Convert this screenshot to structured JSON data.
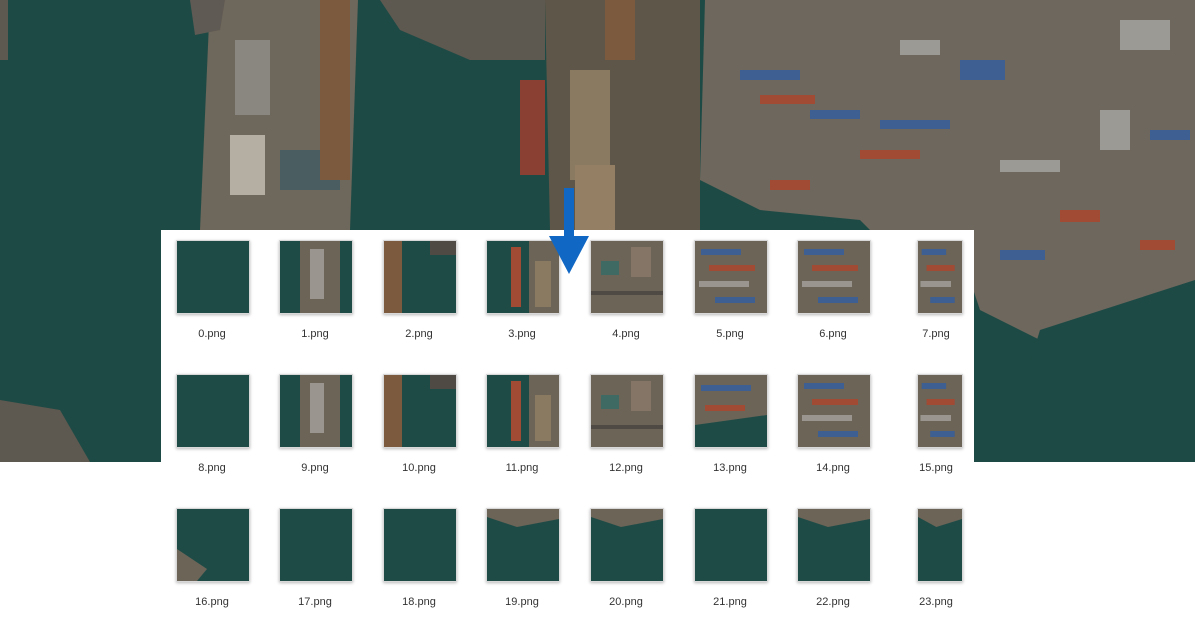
{
  "colors": {
    "water": "#1e4a45",
    "land": "#6b6457",
    "container_blue": "#3d5f92",
    "container_red": "#a14a34",
    "arrow": "#1167c4"
  },
  "icons": {
    "arrow": "down-arrow-icon"
  },
  "tiles": [
    {
      "file": "0.png",
      "kind": "water"
    },
    {
      "file": "1.png",
      "kind": "pier"
    },
    {
      "file": "2.png",
      "kind": "pier-edge"
    },
    {
      "file": "3.png",
      "kind": "ships"
    },
    {
      "file": "4.png",
      "kind": "land"
    },
    {
      "file": "5.png",
      "kind": "containers"
    },
    {
      "file": "6.png",
      "kind": "containers"
    },
    {
      "file": "7.png",
      "kind": "containers"
    },
    {
      "file": "8.png",
      "kind": "water"
    },
    {
      "file": "9.png",
      "kind": "pier"
    },
    {
      "file": "10.png",
      "kind": "pier-edge"
    },
    {
      "file": "11.png",
      "kind": "ships"
    },
    {
      "file": "12.png",
      "kind": "land"
    },
    {
      "file": "13.png",
      "kind": "cranes"
    },
    {
      "file": "14.png",
      "kind": "containers"
    },
    {
      "file": "15.png",
      "kind": "containers"
    },
    {
      "file": "16.png",
      "kind": "shore"
    },
    {
      "file": "17.png",
      "kind": "water"
    },
    {
      "file": "18.png",
      "kind": "water"
    },
    {
      "file": "19.png",
      "kind": "shore-top"
    },
    {
      "file": "20.png",
      "kind": "shore-top"
    },
    {
      "file": "21.png",
      "kind": "water"
    },
    {
      "file": "22.png",
      "kind": "shore-top"
    },
    {
      "file": "23.png",
      "kind": "shore-top"
    }
  ]
}
